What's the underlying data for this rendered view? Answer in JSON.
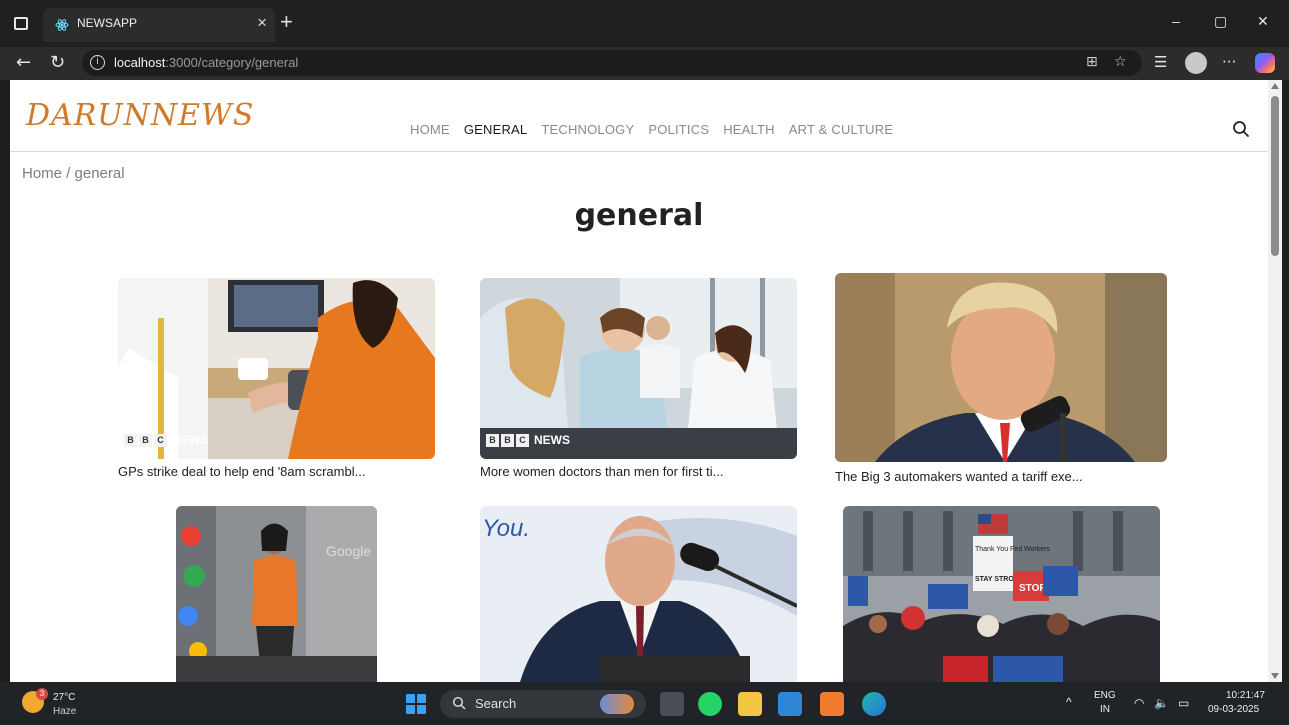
{
  "browser": {
    "tab_title": "NEWSAPP",
    "tab_close": "×",
    "new_tab": "+",
    "url_host": "localhost",
    "url_rest": ":3000/category/general",
    "window_controls": [
      "–",
      "▢",
      "✕"
    ]
  },
  "site": {
    "logo": "DARUNNEWS",
    "nav": [
      {
        "label": "HOME",
        "active": false
      },
      {
        "label": "GENERAL",
        "active": true
      },
      {
        "label": "TECHNOLOGY",
        "active": false
      },
      {
        "label": "POLITICS",
        "active": false
      },
      {
        "label": "HEALTH",
        "active": false
      },
      {
        "label": "ART & CULTURE",
        "active": false
      }
    ],
    "breadcrumb": "Home / general",
    "page_title": "general"
  },
  "articles": [
    {
      "title": "GPs strike deal to help end '8am scrambl...",
      "source_badge": "NEWS",
      "source_letters": [
        "B",
        "B",
        "C"
      ]
    },
    {
      "title": "More women doctors than men for first ti...",
      "source_badge": "NEWS",
      "source_letters": [
        "B",
        "B",
        "C"
      ]
    },
    {
      "title": "The Big 3 automakers wanted a tariff exe..."
    },
    {
      "title": ""
    },
    {
      "title": ""
    },
    {
      "title": ""
    }
  ],
  "image_texts": {
    "you": "You.",
    "google": "Google",
    "sign_thank": "Thank You Fed Workers",
    "sign_stay": "STAY STRONG",
    "sign_stop": "STOP"
  },
  "taskbar": {
    "weather_badge": "3",
    "temperature": "27°C",
    "condition": "Haze",
    "search_label": "Search",
    "lang_top": "ENG",
    "lang_bottom": "IN",
    "time": "10:21:47",
    "date": "09-03-2025",
    "tray_chevron": "^"
  },
  "colors": {
    "logo": "#d07a2a",
    "nav_active": "#1a1a1a",
    "nav_inactive": "#8a8a8a",
    "windows_blue": "#3aa0f3"
  }
}
